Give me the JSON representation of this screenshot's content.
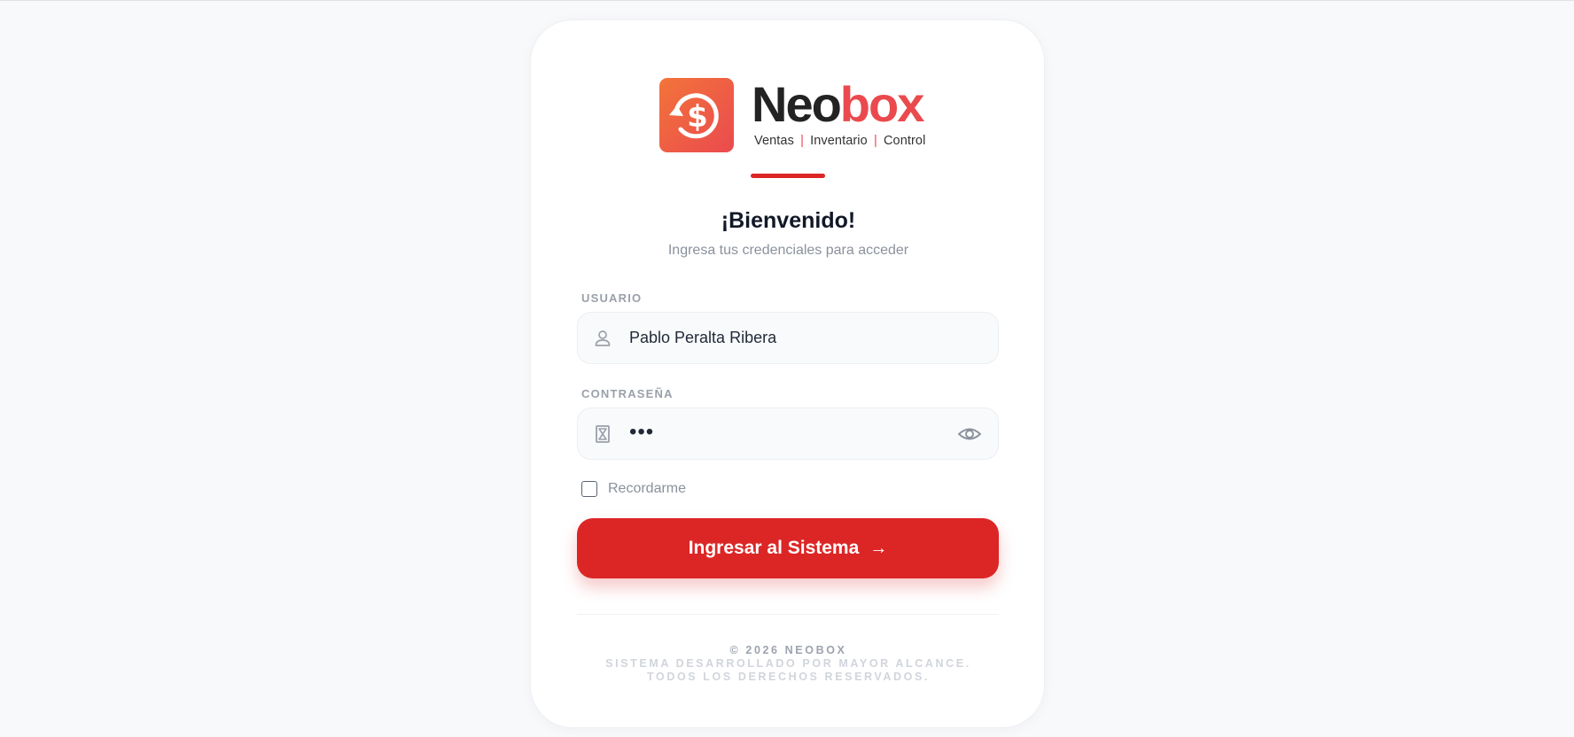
{
  "brand": {
    "name_part1": "Neo",
    "name_part2": "box",
    "tagline_1": "Ventas",
    "tagline_2": "Inventario",
    "tagline_3": "Control",
    "tagline_separator": "|",
    "logo_icon": "dollar-refresh-icon",
    "accent_color": "#ea4a4e"
  },
  "header": {
    "title": "¡Bienvenido!",
    "subtitle": "Ingresa tus credenciales para acceder"
  },
  "form": {
    "username": {
      "label": "USUARIO",
      "value": "Pablo Peralta Ribera",
      "icon": "user-icon"
    },
    "password": {
      "label": "CONTRASEÑA",
      "masked_value": "•••",
      "icon": "hourglass-icon",
      "toggle_icon": "eye-icon"
    },
    "remember": {
      "label": "Recordarme",
      "checked": false
    },
    "submit": {
      "label": "Ingresar al Sistema",
      "arrow": "→",
      "color": "#dc2626"
    }
  },
  "footer": {
    "copyright": "© 2026 NEOBOX",
    "developer": "SISTEMA DESARROLLADO POR MAYOR ALCANCE.",
    "rights": "TODOS LOS DERECHOS RESERVADOS."
  }
}
